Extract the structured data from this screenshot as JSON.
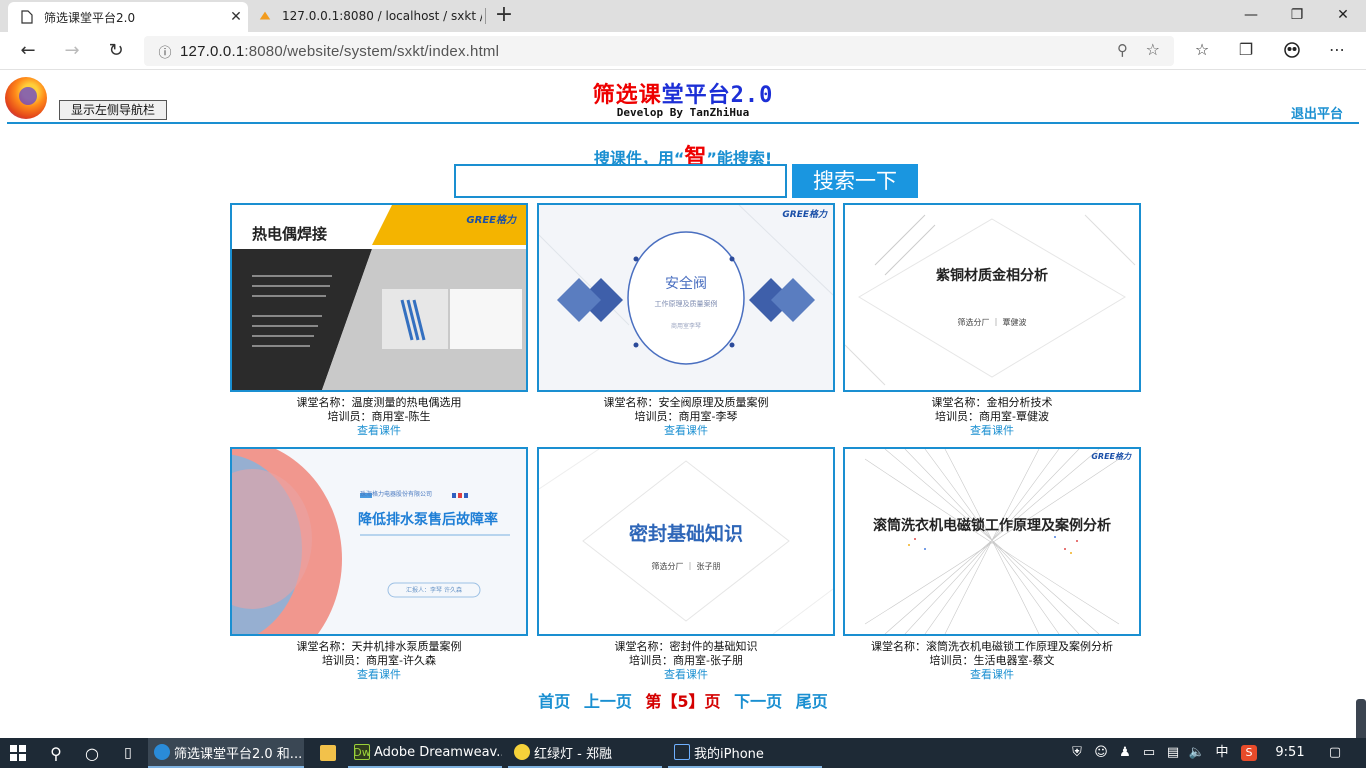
{
  "browser": {
    "tabs": [
      {
        "title": "筛选课堂平台2.0",
        "active": true
      },
      {
        "title": "127.0.0.1:8080 / localhost / sxkt /",
        "active": false
      }
    ],
    "address": {
      "host": "127.0.0.1",
      "rest": ":8080/website/system/sxkt/index.html"
    },
    "window_controls": {
      "minimize": "—",
      "restore": "❐",
      "close": "✕"
    }
  },
  "header": {
    "title_red": "筛选课",
    "title_blue": "堂平台2.0",
    "subtitle": "Develop By TanZhiHua",
    "toggle_nav": "显示左侧导航栏",
    "logout": "退出平台"
  },
  "search": {
    "hint_pre": "搜课件，用“",
    "hint_em": "智",
    "hint_post": "”能搜索!",
    "input_value": "",
    "button": "搜索一下"
  },
  "courses": [
    {
      "name": "课堂名称：温度测量的热电偶选用",
      "trainer": "培训员：商用室-陈生",
      "link": "查看课件",
      "thumb_title": "热电偶焊接",
      "brand": "GREE格力"
    },
    {
      "name": "课堂名称：安全阀原理及质量案例",
      "trainer": "培训员：商用室-李琴",
      "link": "查看课件",
      "thumb_title": "安全阀",
      "thumb_sub": "工作原理及质量案例",
      "thumb_sub2": "商用室李琴",
      "brand": "GREE格力"
    },
    {
      "name": "课堂名称：金相分析技术",
      "trainer": "培训员：商用室-覃健波",
      "link": "查看课件",
      "thumb_title": "紫铜材质金相分析",
      "thumb_sub": "筛选分厂 ｜ 覃健波"
    },
    {
      "name": "课堂名称：天井机排水泵质量案例",
      "trainer": "培训员：商用室-许久森",
      "link": "查看课件",
      "thumb_title": "降低排水泵售后故障率",
      "thumb_sub": "珠海格力电器股份有限公司",
      "thumb_sub2": "汇报人：李琴 许久森"
    },
    {
      "name": "课堂名称：密封件的基础知识",
      "trainer": "培训员：商用室-张子朋",
      "link": "查看课件",
      "thumb_title": "密封基础知识",
      "thumb_sub": "筛选分厂 ｜ 张子朋"
    },
    {
      "name": "课堂名称：滚筒洗衣机电磁锁工作原理及案例分析",
      "trainer": "培训员：生活电器室-蔡文",
      "link": "查看课件",
      "thumb_title": "滚筒洗衣机电磁锁工作原理及案例分析",
      "brand": "GREE格力"
    }
  ],
  "pager": {
    "first": "首页",
    "prev": "上一页",
    "current": "第【5】页",
    "next": "下一页",
    "last": "尾页"
  },
  "taskbar": {
    "items": [
      {
        "label": "筛选课堂平台2.0 和...",
        "active": true
      },
      {
        "label": "",
        "active": false
      },
      {
        "label": "Adobe Dreamweav...",
        "active": false
      },
      {
        "label": "红绿灯 - 郑融",
        "active": false
      },
      {
        "label": "我的iPhone",
        "active": false
      }
    ],
    "ime": "中",
    "time": "9:51"
  }
}
